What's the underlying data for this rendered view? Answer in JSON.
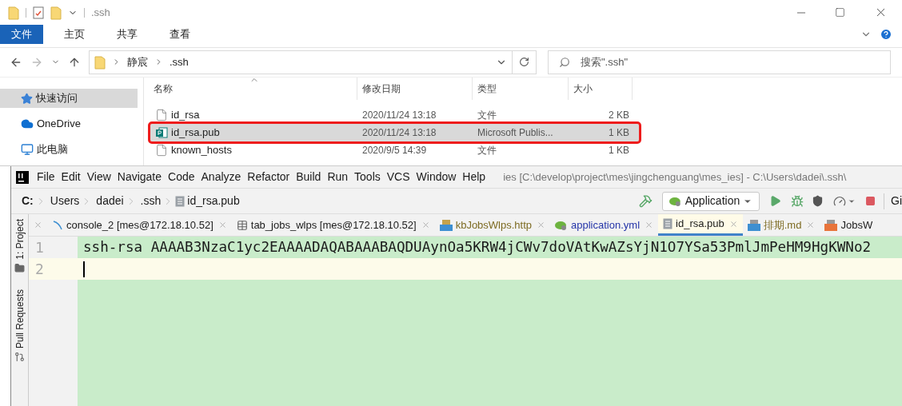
{
  "explorer": {
    "title": ".ssh",
    "ribbon_tabs": [
      {
        "label": "文件",
        "selected": true
      },
      {
        "label": "主页",
        "selected": false
      },
      {
        "label": "共享",
        "selected": false
      },
      {
        "label": "查看",
        "selected": false
      }
    ],
    "address": [
      "静宸",
      ".ssh"
    ],
    "search": {
      "placeholder": "搜索\".ssh\""
    },
    "sidebar": [
      {
        "label": "快速访问",
        "selected": true,
        "kind": "star"
      },
      {
        "label": "OneDrive",
        "selected": false,
        "kind": "cloud"
      },
      {
        "label": "此电脑",
        "selected": false,
        "kind": "pc"
      }
    ],
    "columns": [
      "名称",
      "修改日期",
      "类型",
      "大小"
    ],
    "rows": [
      {
        "name": "id_rsa",
        "date": "2020/11/24 13:18",
        "type": "文件",
        "size": "2 KB",
        "kind": "file",
        "selected": false,
        "highlighted": false
      },
      {
        "name": "id_rsa.pub",
        "date": "2020/11/24 13:18",
        "type": "Microsoft Publis...",
        "size": "1 KB",
        "kind": "publisher",
        "selected": true,
        "highlighted": true
      },
      {
        "name": "known_hosts",
        "date": "2020/9/5 14:39",
        "type": "文件",
        "size": "1 KB",
        "kind": "file",
        "selected": false,
        "highlighted": false
      }
    ]
  },
  "ide": {
    "menu": [
      "File",
      "Edit",
      "View",
      "Navigate",
      "Code",
      "Analyze",
      "Refactor",
      "Build",
      "Run",
      "Tools",
      "VCS",
      "Window",
      "Help"
    ],
    "title": "ies [C:\\develop\\project\\mes\\jingchenguang\\mes_ies] - C:\\Users\\dadei\\.ssh\\",
    "breadcrumb": [
      "C:",
      "Users",
      "dadei",
      ".ssh",
      "id_rsa.pub"
    ],
    "run_config": "Application",
    "toolbar_cut": "Gi",
    "tool_windows": [
      {
        "label": "1: Project",
        "kind": "folder"
      },
      {
        "label": "Pull Requests",
        "kind": "pr"
      }
    ],
    "tabs": [
      {
        "label": "console_2 [mes@172.18.10.52]",
        "kind": "console",
        "selected": false,
        "color": "#1a1a1a"
      },
      {
        "label": "tab_jobs_wlps [mes@172.18.10.52]",
        "kind": "table",
        "selected": false,
        "color": "#1a1a1a"
      },
      {
        "label": "kbJobsWlps.http",
        "kind": "api",
        "selected": false,
        "color": "#7d6b22"
      },
      {
        "label": "application.yml",
        "kind": "spring",
        "selected": false,
        "color": "#2535a8"
      },
      {
        "label": "id_rsa.pub",
        "kind": "text",
        "selected": true,
        "color": "#1a1a1a"
      },
      {
        "label": "排期.md",
        "kind": "md",
        "selected": false,
        "color": "#7d6b22"
      },
      {
        "label": "JobsW",
        "kind": "xml",
        "selected": false,
        "color": "#1a1a1a"
      }
    ],
    "lines": [
      {
        "number": "1",
        "text": "ssh-rsa AAAAB3NzaC1yc2EAAAADAQABAAABAQDUAynOa5KRW4jCWv7doVAtKwAZsYjN1O7YSa53PmlJmPeHM9HgKWNo2",
        "current": false
      },
      {
        "number": "2",
        "current": true
      }
    ]
  }
}
